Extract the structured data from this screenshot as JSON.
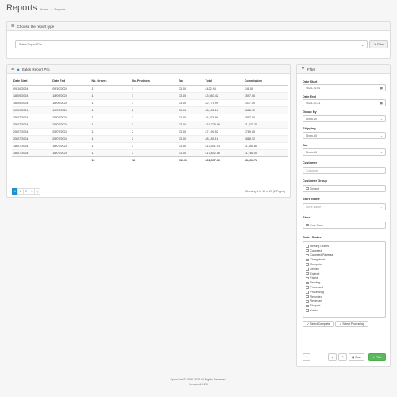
{
  "header": {
    "title": "Reports",
    "breadcrumb": [
      "Home",
      "Reports"
    ]
  },
  "report_type": {
    "title": "Choose the report type",
    "selected": "Sales Report Pro",
    "filter_label": "Filter"
  },
  "report": {
    "title": "Sales Report Pro",
    "columns": [
      "Date Start",
      "Date End",
      "No. Orders",
      "No. Products",
      "Tax",
      "Total",
      "Commission"
    ],
    "rows": [
      [
        "09/10/2024",
        "09/10/2024",
        "1",
        "1",
        "£3.00",
        "£422.94",
        "£41.58"
      ],
      [
        "18/09/2024",
        "18/09/2024",
        "1",
        "1",
        "£3.00",
        "£3,983.42",
        "£597.06"
      ],
      [
        "16/09/2024",
        "16/09/2024",
        "1",
        "1",
        "£3.00",
        "£2,775.99",
        "£477.00"
      ],
      [
        "10/09/2024",
        "10/09/2024",
        "1",
        "2",
        "£3.00",
        "£8,185.16",
        "£818.22"
      ],
      [
        "25/07/2024",
        "25/07/2024",
        "1",
        "2",
        "£3.00",
        "£4,876.96",
        "£887.40"
      ],
      [
        "25/07/2024",
        "25/07/2024",
        "1",
        "1",
        "£3.00",
        "£10,775.99",
        "£1,077.30"
      ],
      [
        "25/07/2024",
        "25/07/2024",
        "1",
        "2",
        "£3.00",
        "£7,190.52",
        "£719.55"
      ],
      [
        "25/07/2024",
        "25/07/2024",
        "1",
        "2",
        "£3.00",
        "£8,185.16",
        "£818.22"
      ],
      [
        "18/07/2024",
        "18/07/2024",
        "1",
        "3",
        "£3.00",
        "£13,541.43",
        "£1,353.80"
      ],
      [
        "18/07/2024",
        "18/07/2024",
        "1",
        "3",
        "£3.00",
        "£17,842.06",
        "£1,784.00"
      ]
    ],
    "totals": [
      "",
      "",
      "10",
      "18",
      "£30.00",
      "£61,597.06",
      "£8,159.71"
    ],
    "pages": [
      "1",
      "2",
      "3",
      ">",
      ">|"
    ],
    "showing": "Showing 1 to 10 of 20 (2 Pages)"
  },
  "filter": {
    "title": "Filter",
    "date_start_label": "Date Start",
    "date_start": "2024-10-01",
    "date_end_label": "Date End",
    "date_end": "2024-10-31",
    "group_by_label": "Group By",
    "group_by": "Show All",
    "shipping_label": "Shipping",
    "shipping": "Show All",
    "tax_label": "Tax",
    "tax": "Show All",
    "customer_label": "Customer",
    "customer_placeholder": "Customer",
    "customer_group_label": "Customer Group",
    "customer_group": "Default",
    "store_name_label": "Store Name",
    "store_name_placeholder": "Store Name",
    "store_label": "Store",
    "store": "Your Store",
    "order_status_label": "Order Status",
    "order_statuses": [
      "Missing Orders",
      "Canceled",
      "Canceled Reversal",
      "Chargeback",
      "Complete",
      "Denied",
      "Expired",
      "Failed",
      "Pending",
      "Processed",
      "Processing",
      "Refunded",
      "Reversed",
      "Shipped",
      "Voided"
    ],
    "select_complete": "Select Complete",
    "select_processing": "Select Processing",
    "save_label": "Save",
    "filter_label": "Filter"
  },
  "footer": {
    "brand": "OpenCart",
    "copyright": "© 2009-2024 All Rights Reserved.",
    "version": "Version 4.0.2.1"
  },
  "colors": {
    "accent": "#1e91cf",
    "success": "#5cb85c"
  }
}
